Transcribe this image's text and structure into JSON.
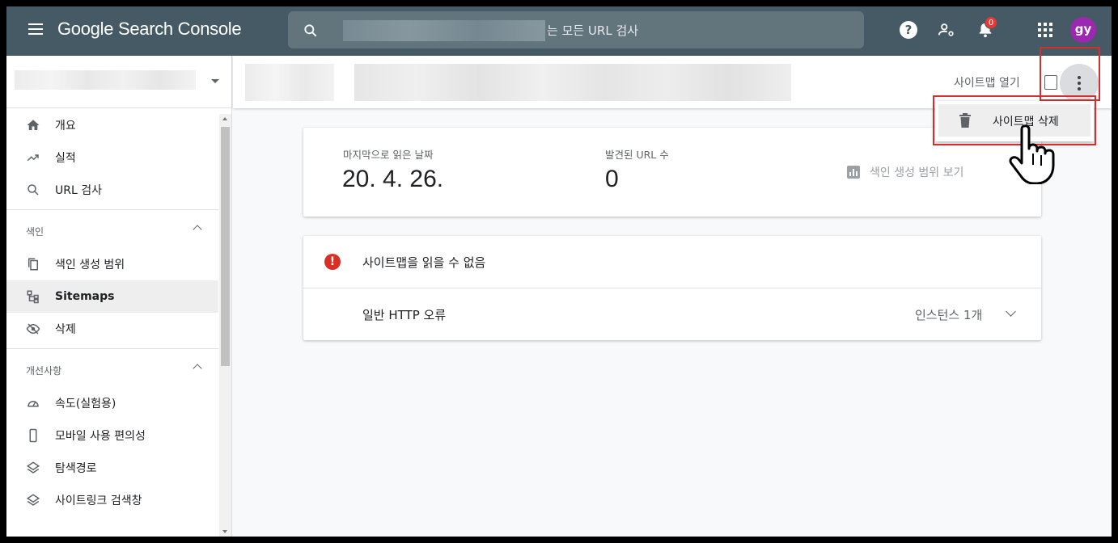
{
  "app": {
    "title": "Google Search Console",
    "search_placeholder": "속성의 모든 URL 검사",
    "search_visible_text": "는 모든 URL 검사",
    "notification_count": "0",
    "avatar_initials": "gy",
    "colors": {
      "topbar": "#455a64",
      "avatar": "#9c27b0",
      "badge": "#e53935",
      "highlight": "#d32f2f"
    }
  },
  "sidebar": {
    "items_top": [
      {
        "label": "개요",
        "icon": "home-icon"
      },
      {
        "label": "실적",
        "icon": "trending-up-icon"
      },
      {
        "label": "URL 검사",
        "icon": "search-icon"
      }
    ],
    "section_index": {
      "label": "색인"
    },
    "items_index": [
      {
        "label": "색인 생성 범위",
        "icon": "copy-icon"
      },
      {
        "label": "Sitemaps",
        "icon": "sitemap-icon",
        "active": true
      },
      {
        "label": "삭제",
        "icon": "visibility-off-icon"
      }
    ],
    "section_enhancements": {
      "label": "개선사항"
    },
    "items_enhancements": [
      {
        "label": "속도(실험용)",
        "icon": "speed-icon"
      },
      {
        "label": "모바일 사용 편의성",
        "icon": "phone-icon"
      },
      {
        "label": "탐색경로",
        "icon": "layers-icon"
      },
      {
        "label": "사이트링크 검색창",
        "icon": "layers-icon"
      }
    ]
  },
  "header": {
    "open_sitemap": "사이트맵 열기",
    "more_menu": {
      "delete_sitemap": "사이트맵 삭제"
    }
  },
  "summary": {
    "last_read_label": "마지막으로 읽은 날짜",
    "last_read_value": "20. 4. 26.",
    "discovered_urls_label": "발견된 URL 수",
    "discovered_urls_value": "0",
    "coverage_link": "색인 생성 범위 보기"
  },
  "errors": {
    "title": "사이트맵을 읽을 수 없음",
    "row_label": "일반 HTTP 오류",
    "row_count": "인스턴스 1개"
  }
}
